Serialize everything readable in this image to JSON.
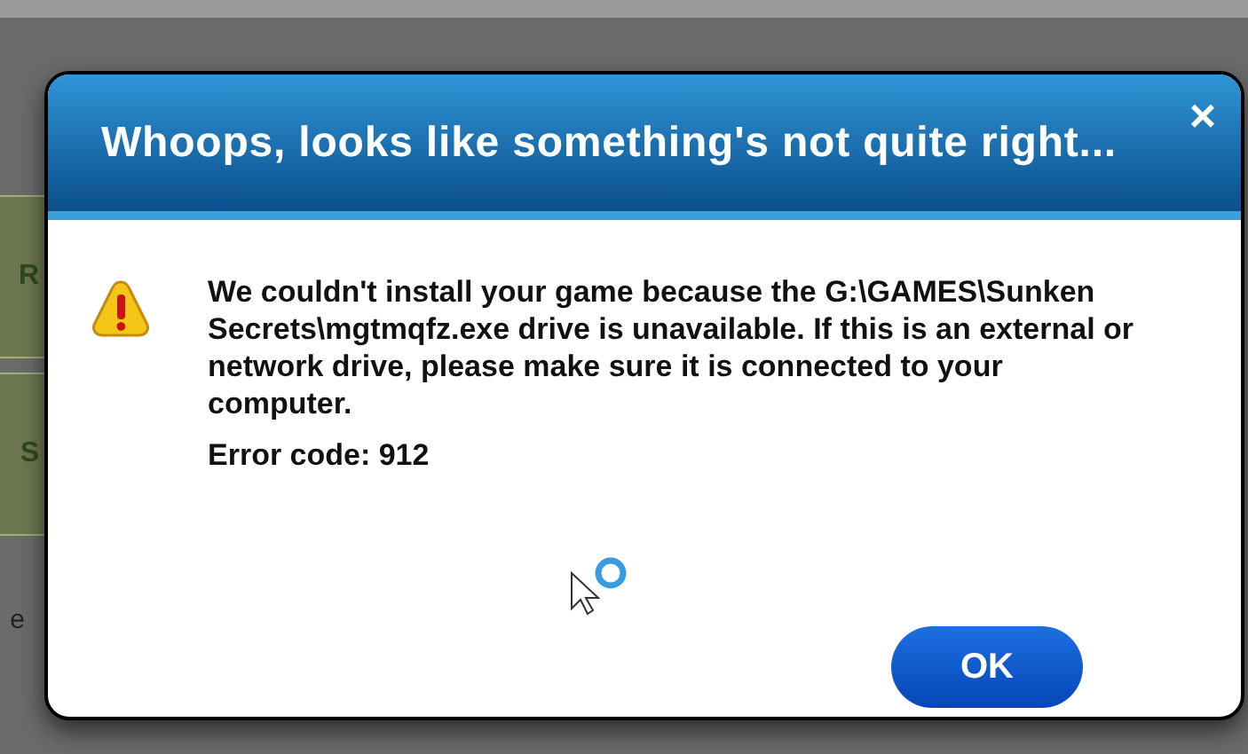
{
  "background": {
    "fragments": [
      {
        "text": "R",
        "kind": "panel"
      },
      {
        "text": "S",
        "kind": "panel"
      },
      {
        "text": "e",
        "kind": "plain"
      }
    ]
  },
  "dialog": {
    "title": "Whoops, looks like something's not quite right...",
    "close": "×",
    "message": "We couldn't install your game because the G:\\GAMES\\Sunken Secrets\\mgtmqfz.exe drive is unavailable. If this is an external or network drive, please make sure it is connected to your computer.",
    "error_code": "Error code: 912",
    "button": "OK"
  }
}
